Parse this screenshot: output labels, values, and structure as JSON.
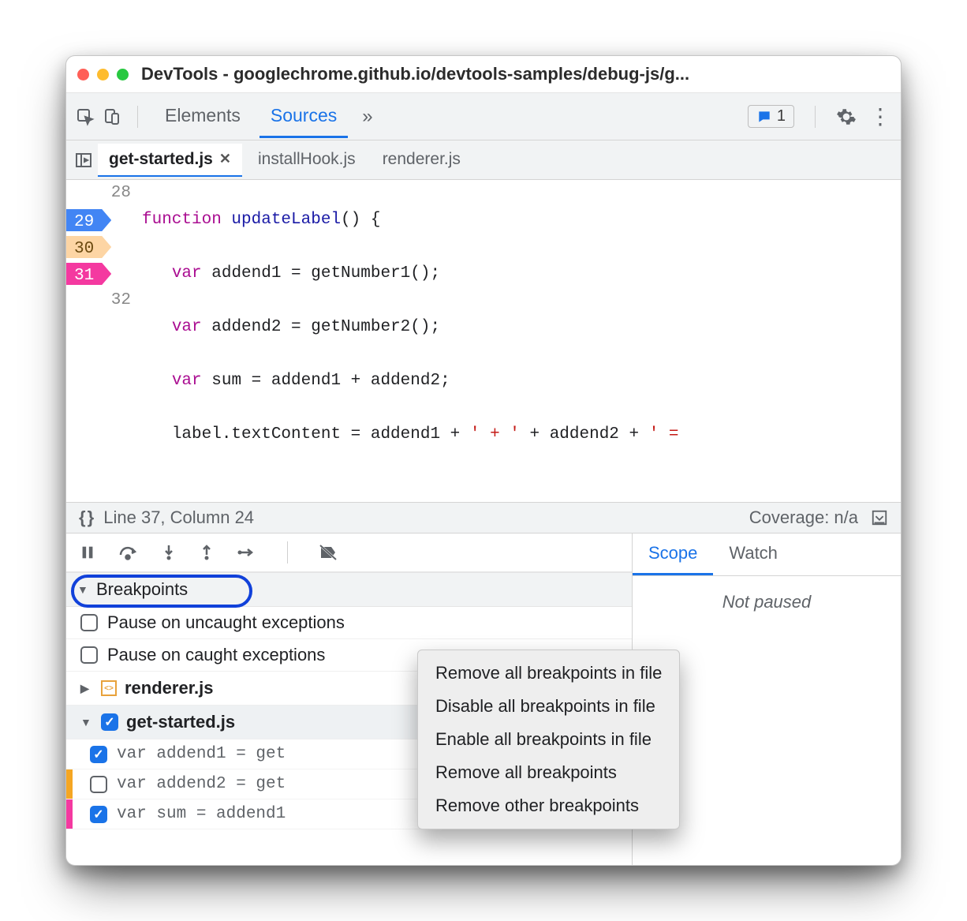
{
  "window": {
    "title": "DevTools - googlechrome.github.io/devtools-samples/debug-js/g..."
  },
  "toolbar": {
    "tabs": {
      "elements": "Elements",
      "sources": "Sources"
    },
    "issue_count": "1"
  },
  "file_tabs": [
    "get-started.js",
    "installHook.js",
    "renderer.js"
  ],
  "source": {
    "lines": [
      {
        "num": "28",
        "t1": "function ",
        "t2": "updateLabel",
        "t3": "() {"
      },
      {
        "num": "29",
        "t1": "var ",
        "t2": "addend1 = getNumber1();"
      },
      {
        "num": "30",
        "t1": "var ",
        "t2": "addend2 = getNumber2();"
      },
      {
        "num": "31",
        "t1": "var ",
        "t2": "sum = addend1 + addend2;"
      },
      {
        "num": "32",
        "t1": "label.textContent = addend1 + ",
        "t2": "' + '",
        "t3": " + addend2 + ",
        "t4": "' ="
      }
    ]
  },
  "status": {
    "position": "Line 37, Column 24",
    "coverage": "Coverage: n/a"
  },
  "breakpoints_panel": {
    "header": "Breakpoints",
    "opts": {
      "uncaught": "Pause on uncaught exceptions",
      "caught": "Pause on caught exceptions"
    },
    "files": {
      "renderer": "renderer.js",
      "getstarted": "get-started.js"
    },
    "entries": [
      "var addend1 = get",
      "var addend2 = get",
      "var sum = addend1"
    ]
  },
  "right_panel": {
    "scope": "Scope",
    "watch": "Watch",
    "not_paused": "Not paused"
  },
  "context_menu": [
    "Remove all breakpoints in file",
    "Disable all breakpoints in file",
    "Enable all breakpoints in file",
    "Remove all breakpoints",
    "Remove other breakpoints"
  ]
}
